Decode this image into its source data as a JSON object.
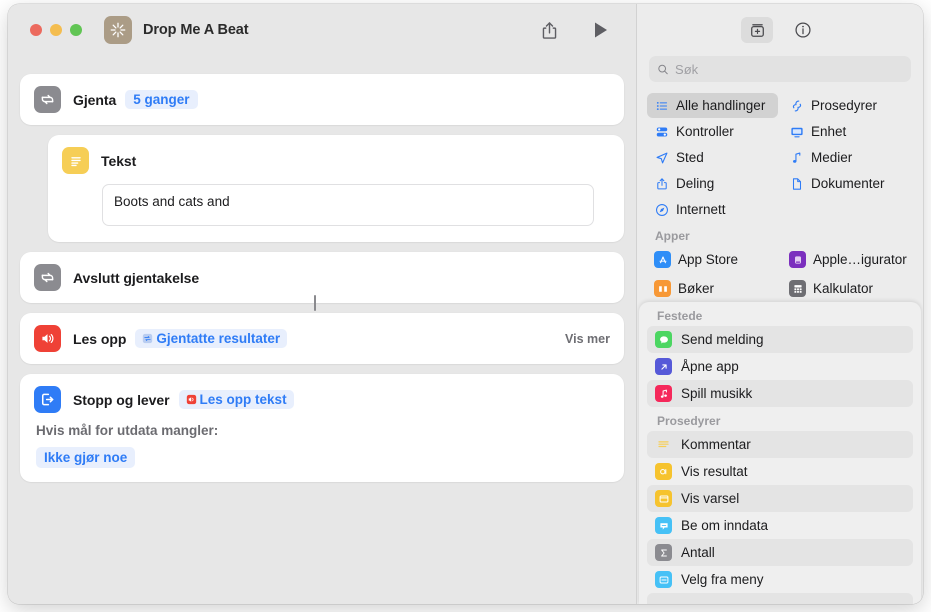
{
  "window": {
    "title": "Drop Me A Beat",
    "app_icon": "shortcut-sparkle-icon",
    "traffic_lights": [
      "close-button",
      "minimize-button",
      "zoom-button"
    ],
    "toolbar": {
      "share_label": "share-icon",
      "run_label": "run-play-icon"
    }
  },
  "editor": {
    "actions": [
      {
        "id": "repeat",
        "title": "Gjenta",
        "icon": "repeat-icon",
        "icon_color": "#8b8b90",
        "token": "5 ganger",
        "token_icon": null
      },
      {
        "id": "text",
        "title": "Tekst",
        "icon": "text-icon",
        "icon_color": "#f6ce56",
        "value": "Boots and cats and",
        "placeholder": "Tekst"
      },
      {
        "id": "end-repeat",
        "title": "Avslutt gjentakelse",
        "icon": "repeat-icon",
        "icon_color": "#8b8b90"
      },
      {
        "id": "speak",
        "title": "Les opp",
        "icon": "speaker-icon",
        "icon_color": "#ef4136",
        "token": "Gjentatte resultater",
        "token_icon": "repeat-variable-icon",
        "show_more": "Vis mer"
      },
      {
        "id": "stop-and-output",
        "title": "Stopp og lever",
        "icon": "stop-output-icon",
        "icon_color": "#2f7cf6",
        "token": "Les opp tekst",
        "token_icon": "speaker-variable-icon",
        "subtitle": "Hvis mål for utdata mangler:",
        "fallback": "Ikke gjør noe"
      }
    ]
  },
  "sidebar": {
    "toolbar": {
      "library_button": "action-library-icon",
      "info_button": "info-circle-icon"
    },
    "search": {
      "placeholder": "Søk",
      "value": "",
      "icon": "search-icon"
    },
    "categories": [
      {
        "label": "Alle handlinger",
        "icon": "list-bullet-icon",
        "selected": true
      },
      {
        "label": "Prosedyrer",
        "icon": "scripting-icon",
        "selected": false
      },
      {
        "label": "Kontroller",
        "icon": "controls-icon",
        "selected": false
      },
      {
        "label": "Enhet",
        "icon": "display-icon",
        "selected": false
      },
      {
        "label": "Sted",
        "icon": "location-arrow-icon",
        "selected": false
      },
      {
        "label": "Medier",
        "icon": "music-note-icon",
        "selected": false
      },
      {
        "label": "Deling",
        "icon": "share-up-icon",
        "selected": false
      },
      {
        "label": "Dokumenter",
        "icon": "document-icon",
        "selected": false
      },
      {
        "label": "Internett",
        "icon": "safari-compass-icon",
        "selected": false
      }
    ],
    "apps_section": {
      "header": "Apper",
      "items": [
        {
          "label": "App Store",
          "icon": "app-store-icon",
          "color": "#2f8ef7"
        },
        {
          "label": "Apple…igurator",
          "icon": "apple-configurator-icon",
          "color": "#7b2fbe"
        },
        {
          "label": "Bøker",
          "icon": "books-icon",
          "color": "#f79836"
        },
        {
          "label": "Kalkulator",
          "icon": "calculator-icon",
          "color": "#6e6e73"
        }
      ]
    },
    "pinned_section": {
      "header": "Festede",
      "items": [
        {
          "label": "Send melding",
          "icon": "messages-icon",
          "color": "#4cd662"
        },
        {
          "label": "Åpne app",
          "icon": "open-app-icon",
          "color": "#5659d8"
        },
        {
          "label": "Spill musikk",
          "icon": "music-icon",
          "color": "#f5285a"
        }
      ]
    },
    "scripting_section": {
      "header": "Prosedyrer",
      "items": [
        {
          "label": "Kommentar",
          "icon": "comment-icon",
          "color": "#f6ce56"
        },
        {
          "label": "Vis resultat",
          "icon": "quick-look-icon",
          "color": "#f6c32e"
        },
        {
          "label": "Vis varsel",
          "icon": "alert-icon",
          "color": "#f6c32e"
        },
        {
          "label": "Be om inndata",
          "icon": "ask-input-icon",
          "color": "#46c1f6"
        },
        {
          "label": "Antall",
          "icon": "count-sigma-icon",
          "color": "#8b8b90"
        },
        {
          "label": "Velg fra meny",
          "icon": "choose-menu-icon",
          "color": "#46c1f6"
        }
      ]
    }
  },
  "colors": {
    "accent": "#2f7cf6",
    "token_bg": "#e8effd",
    "window_bg": "#e7e7e7",
    "sidebar_bg": "#ececec"
  }
}
